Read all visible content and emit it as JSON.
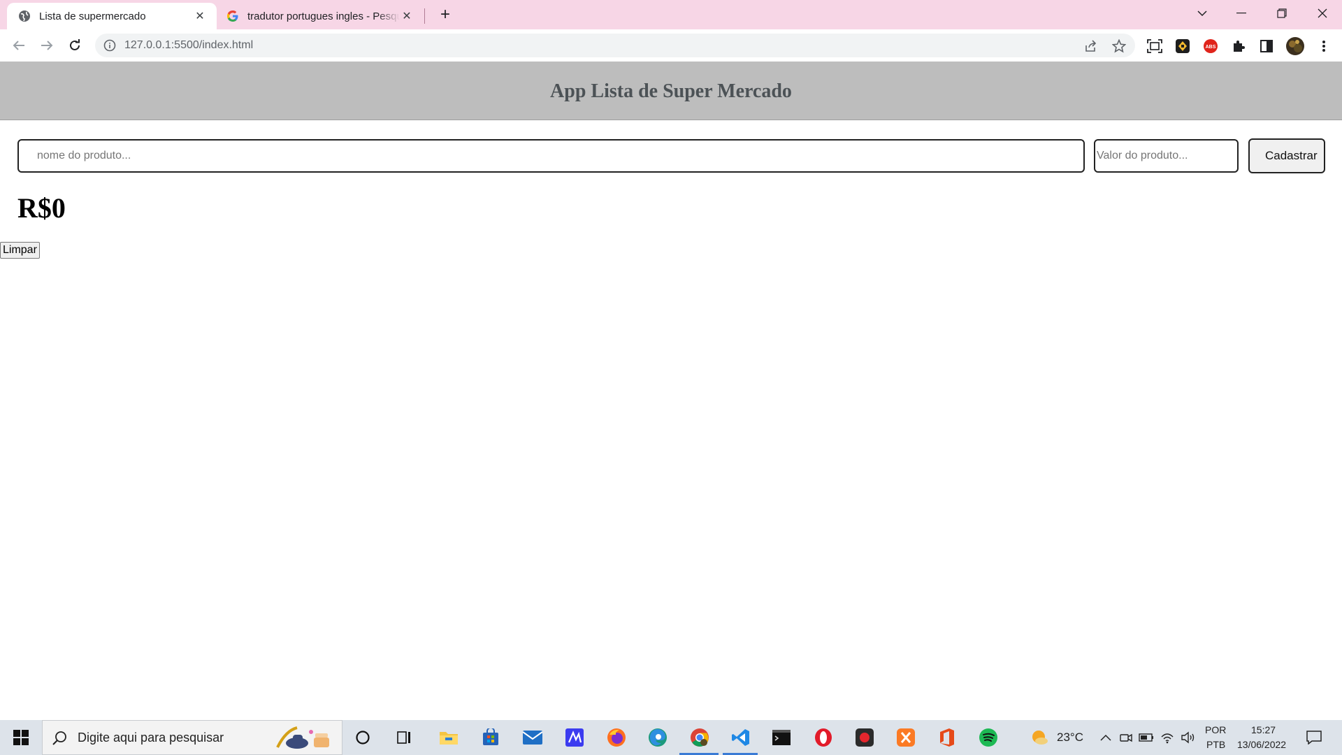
{
  "browser": {
    "tabs": [
      {
        "title": "Lista de supermercado",
        "active": true,
        "icon": "globe-icon"
      },
      {
        "title": "tradutor portugues ingles - Pesquisa Google",
        "active": false,
        "icon": "google-icon"
      }
    ],
    "address": "127.0.0.1:5500/index.html",
    "extensions": [
      "screen-capture-icon",
      "crypto-extension-icon",
      "adblock-icon",
      "puzzle-icon",
      "side-panel-icon",
      "profile-avatar",
      "menu-kebab-icon"
    ]
  },
  "app": {
    "title": "App Lista de Super Mercado",
    "name_placeholder": "nome do produto...",
    "value_placeholder": "Valor do produto...",
    "register_label": "Cadastrar",
    "total": "R$0",
    "clear_label": "Limpar"
  },
  "taskbar": {
    "search_placeholder": "Digite aqui para pesquisar",
    "apps": [
      "cortana-icon",
      "task-view-icon",
      "file-explorer-icon",
      "microsoft-store-icon",
      "mail-icon",
      "vscode-insiders-icon",
      "firefox-icon",
      "edge-icon",
      "chrome-icon",
      "vscode-icon",
      "terminal-icon",
      "opera-icon",
      "recorder-icon",
      "xampp-icon",
      "office-icon",
      "spotify-icon"
    ],
    "weather": "23°C",
    "language_top": "POR",
    "language_bottom": "PTB",
    "time": "15:27",
    "date": "13/06/2022"
  }
}
